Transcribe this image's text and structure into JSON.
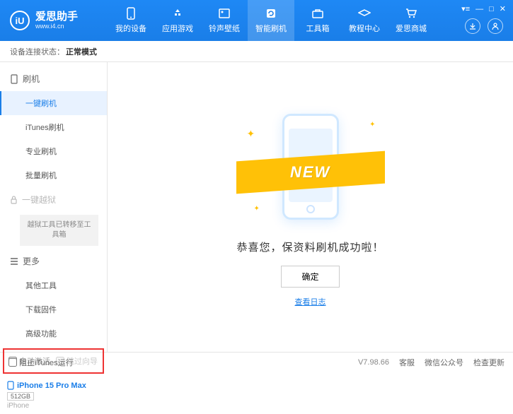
{
  "brand": {
    "name": "爱思助手",
    "url": "www.i4.cn"
  },
  "nav": {
    "items": [
      {
        "label": "我的设备"
      },
      {
        "label": "应用游戏"
      },
      {
        "label": "铃声壁纸"
      },
      {
        "label": "智能刷机"
      },
      {
        "label": "工具箱"
      },
      {
        "label": "教程中心"
      },
      {
        "label": "爱思商城"
      }
    ],
    "active": 3
  },
  "status": {
    "label": "设备连接状态：",
    "value": "正常模式"
  },
  "sidebar": {
    "flash_header": "刷机",
    "items": [
      {
        "label": "一键刷机"
      },
      {
        "label": "iTunes刷机"
      },
      {
        "label": "专业刷机"
      },
      {
        "label": "批量刷机"
      }
    ],
    "jailbreak_header": "一键越狱",
    "jailbreak_notice": "越狱工具已转移至工具箱",
    "more_header": "更多",
    "more_items": [
      {
        "label": "其他工具"
      },
      {
        "label": "下载固件"
      },
      {
        "label": "高级功能"
      }
    ],
    "checks": {
      "auto_activate": "自动激活",
      "skip_guide": "跳过向导"
    }
  },
  "device": {
    "name": "iPhone 15 Pro Max",
    "storage": "512GB",
    "type": "iPhone"
  },
  "content": {
    "ribbon": "NEW",
    "message": "恭喜您，保资料刷机成功啦！",
    "ok": "确定",
    "log_link": "查看日志"
  },
  "footer": {
    "block_itunes": "阻止iTunes运行",
    "version": "V7.98.66",
    "links": [
      "客服",
      "微信公众号",
      "检查更新"
    ]
  }
}
